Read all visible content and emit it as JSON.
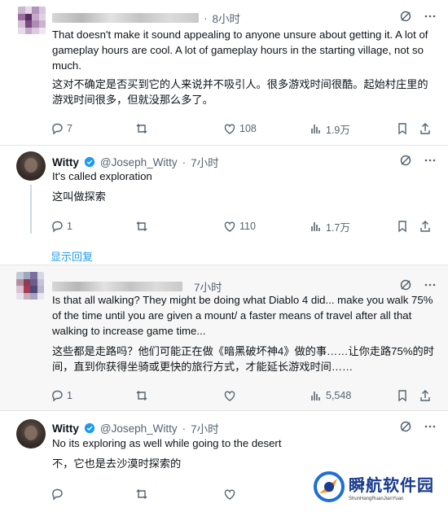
{
  "tweets": [
    {
      "time": "8小时",
      "text_en": "That doesn't make it sound appealing to anyone unsure about getting it. A lot of gameplay hours are cool. A lot of gameplay hours in the starting village, not so much.",
      "text_zh": "这对不确定是否买到它的人来说并不吸引人。很多游戏时间很酷。起始村庄里的游戏时间很多，但就没那么多了。",
      "replies": "7",
      "retweets": "",
      "likes": "108",
      "views": "1.9万"
    },
    {
      "name": "Witty",
      "handle": "@Joseph_Witty",
      "dot": "·",
      "time": "7小时",
      "text_en": "It's called exploration",
      "text_zh": "这叫做探索",
      "replies": "1",
      "retweets": "",
      "likes": "110",
      "views": "1.7万"
    },
    {
      "time": "7小时",
      "text_en": "Is that all walking? They might be doing what Diablo 4 did... make you walk 75% of the time until you are given a mount/ a faster means of travel after all that walking to increase game time...",
      "text_zh": "这些都是走路吗？他们可能正在做《暗黑破坏神4》做的事……让你走路75%的时间，直到你获得坐骑或更快的旅行方式，才能延长游戏时间……",
      "replies": "1",
      "retweets": "",
      "likes": "",
      "views": "5,548"
    },
    {
      "name": "Witty",
      "handle": "@Joseph_Witty",
      "dot": "·",
      "time": "7小时",
      "text_en": "No its exploring as well while going to the desert",
      "text_zh": "不，它也是去沙漠时探索的",
      "replies": "",
      "retweets": "",
      "likes": "",
      "views": ""
    }
  ],
  "show_replies": "显示回复",
  "watermark": {
    "title": "瞬航软件园",
    "subtitle": "ShunHangRuanJianYuan"
  },
  "colors": {
    "accent": "#1d9bf0",
    "muted": "#536471",
    "text": "#0f1419"
  }
}
